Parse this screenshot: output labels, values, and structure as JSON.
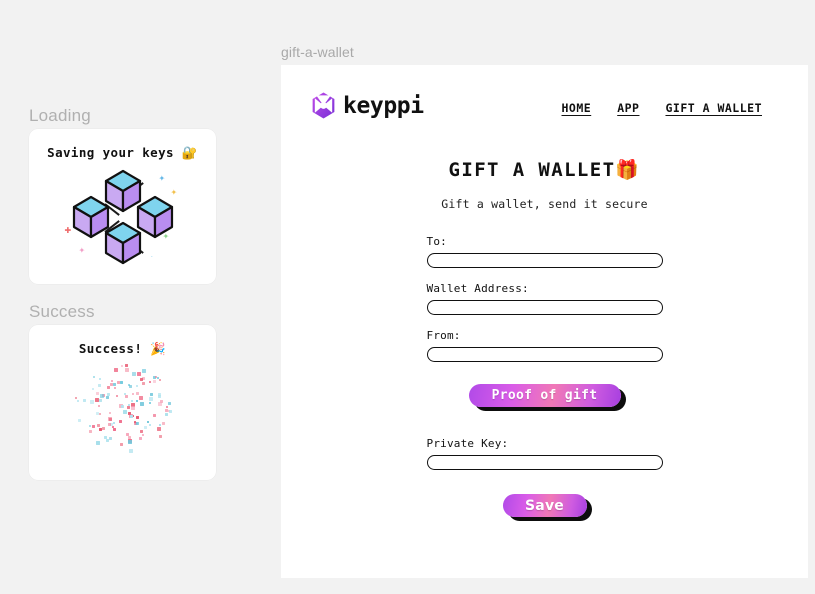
{
  "page": {
    "tag": "gift-a-wallet",
    "background_color": "#f2f2f2",
    "panel_color": "#ffffff"
  },
  "sidebar": {
    "sections": [
      {
        "label": "Loading",
        "card_title": "Saving your keys 🔐",
        "art": "blockchain-cubes"
      },
      {
        "label": "Success",
        "card_title": "Success! 🎉",
        "art": "confetti-burst"
      }
    ]
  },
  "header": {
    "brand_name": "keyppi",
    "brand_icon": "keyppi-hexagon-logo",
    "nav": [
      {
        "label": "HOME"
      },
      {
        "label": "APP"
      },
      {
        "label": "GIFT A WALLET"
      }
    ]
  },
  "hero": {
    "title": "GIFT A WALLET🎁",
    "subtitle": "Gift a wallet, send it secure"
  },
  "form": {
    "fields": [
      {
        "label": "To:",
        "value": "",
        "placeholder": ""
      },
      {
        "label": "Wallet Address:",
        "value": "",
        "placeholder": ""
      },
      {
        "label": "From:",
        "value": "",
        "placeholder": ""
      }
    ],
    "private_key_field": {
      "label": "Private Key:",
      "value": "",
      "placeholder": ""
    },
    "proof_button": "Proof of gift",
    "save_button": "Save"
  },
  "colors": {
    "accent_purple": "#b14ae8",
    "accent_pink": "#f078b6",
    "cube_top": "#7fd4ee",
    "cube_side_left": "#c4a6f0",
    "cube_side_right": "#b98df0",
    "shadow": "#0d0d0d",
    "muted_text": "#b0b0b0"
  }
}
